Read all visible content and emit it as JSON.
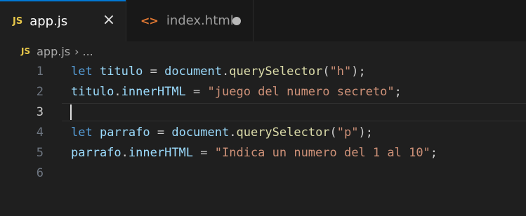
{
  "tabs": [
    {
      "icon": "JS",
      "label": "app.js",
      "active": true,
      "close_symbol": "×"
    },
    {
      "icon": "<>",
      "label": "index.html",
      "active": false,
      "modified": true
    }
  ],
  "breadcrumb": {
    "icon": "JS",
    "file": "app.js",
    "separator": "›",
    "rest": "..."
  },
  "lines": [
    {
      "number": "1",
      "tokens": [
        {
          "t": "let",
          "c": "kw"
        },
        {
          "t": " ",
          "c": "punc"
        },
        {
          "t": "titulo",
          "c": "var"
        },
        {
          "t": " = ",
          "c": "punc"
        },
        {
          "t": "document",
          "c": "var"
        },
        {
          "t": ".",
          "c": "punc"
        },
        {
          "t": "querySelector",
          "c": "fn"
        },
        {
          "t": "(",
          "c": "punc"
        },
        {
          "t": "\"h\"",
          "c": "str"
        },
        {
          "t": ");",
          "c": "punc"
        }
      ]
    },
    {
      "number": "2",
      "tokens": [
        {
          "t": "titulo",
          "c": "var"
        },
        {
          "t": ".",
          "c": "punc"
        },
        {
          "t": "innerHTML",
          "c": "var"
        },
        {
          "t": " = ",
          "c": "punc"
        },
        {
          "t": "\"juego del numero secreto\"",
          "c": "str"
        },
        {
          "t": ";",
          "c": "punc"
        }
      ]
    },
    {
      "number": "3",
      "tokens": [],
      "current": true
    },
    {
      "number": "4",
      "tokens": [
        {
          "t": "let",
          "c": "kw"
        },
        {
          "t": " ",
          "c": "punc"
        },
        {
          "t": "parrafo",
          "c": "var"
        },
        {
          "t": " = ",
          "c": "punc"
        },
        {
          "t": "document",
          "c": "var"
        },
        {
          "t": ".",
          "c": "punc"
        },
        {
          "t": "querySelector",
          "c": "fn"
        },
        {
          "t": "(",
          "c": "punc"
        },
        {
          "t": "\"p\"",
          "c": "str"
        },
        {
          "t": ");",
          "c": "punc"
        }
      ]
    },
    {
      "number": "5",
      "tokens": [
        {
          "t": "parrafo",
          "c": "var"
        },
        {
          "t": ".",
          "c": "punc"
        },
        {
          "t": "innerHTML",
          "c": "var"
        },
        {
          "t": " = ",
          "c": "punc"
        },
        {
          "t": "\"Indica un numero del 1 al 10\"",
          "c": "str"
        },
        {
          "t": ";",
          "c": "punc"
        }
      ]
    },
    {
      "number": "6",
      "tokens": []
    }
  ],
  "colors": {
    "keyword": "#569cd6",
    "variable": "#9cdcfe",
    "function": "#dcdcaa",
    "string": "#ce9178",
    "accent": "#0078d4",
    "js_badge": "#e8c84a",
    "html_icon": "#e37933"
  }
}
